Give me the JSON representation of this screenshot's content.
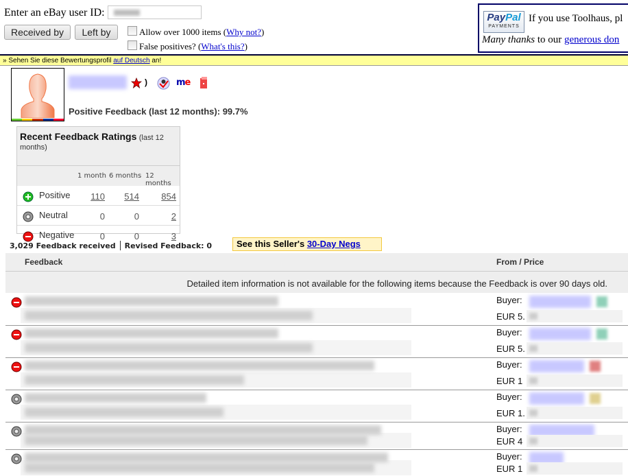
{
  "form": {
    "user_id_label": "Enter an eBay user ID:",
    "user_id_value_redacted": true,
    "received_by_button": "Received by",
    "left_by_button": "Left by",
    "allow_over_1000_label": "Allow over 1000 items",
    "allow_over_1000_checked": false,
    "why_not_link": "Why not?",
    "false_positives_label": "False positives?",
    "false_positives_checked": false,
    "whats_this_link": "What's this?"
  },
  "donate": {
    "paypal_logo_top": "PayPal",
    "paypal_logo_bottom": "PAYMENTS",
    "line1": "If you use Toolhaus, pl",
    "line2_italic": "Many thanks",
    "line2_text": " to our ",
    "line2_link": "generous don"
  },
  "lang_bar": {
    "prefix": "» Sehen Sie diese Bewertungsprofil ",
    "link": "auf Deutsch",
    "suffix": " an!"
  },
  "profile": {
    "username_redacted": true,
    "score_suffix": ")",
    "icons": [
      "red-star-icon",
      "id-verified-icon",
      "me-page-icon",
      "store-door-icon"
    ],
    "positive_feedback_label": "Positive Feedback (last 12 months):",
    "positive_feedback_value": "99.7%"
  },
  "ratings": {
    "title": "Recent Feedback Ratings",
    "title_small": "(last 12 months)",
    "columns": [
      "1 month",
      "6 months",
      "12 months"
    ],
    "rows": [
      {
        "label": "Positive",
        "icon": "positive-icon",
        "values": [
          "110",
          "514",
          "854"
        ],
        "linked": [
          true,
          true,
          true
        ]
      },
      {
        "label": "Neutral",
        "icon": "neutral-icon",
        "values": [
          "0",
          "0",
          "2"
        ],
        "linked": [
          false,
          false,
          true
        ]
      },
      {
        "label": "Negative",
        "icon": "negative-icon",
        "values": [
          "0",
          "0",
          "3"
        ],
        "linked": [
          false,
          false,
          true
        ]
      }
    ]
  },
  "summary": {
    "feedback_received": "3,029 Feedback received",
    "revised_feedback": "Revised Feedback: 0",
    "negs_prefix": "See this Seller's ",
    "negs_link": "30-Day Negs"
  },
  "feedback_table": {
    "col_feedback": "Feedback",
    "col_from_price": "From / Price",
    "notice": "Detailed item information is not available for the following items because the Feedback is over 90 days old.",
    "rows": [
      {
        "type": "negative",
        "buyer_label": "Buyer:",
        "price_prefix": "EUR 5.",
        "star_color": "#8fd0b8"
      },
      {
        "type": "negative",
        "buyer_label": "Buyer:",
        "price_prefix": "EUR 5.",
        "star_color": "#8fd0b8"
      },
      {
        "type": "negative",
        "buyer_label": "Buyer:",
        "price_prefix": "EUR 1",
        "star_color": "#e08080"
      },
      {
        "type": "neutral",
        "buyer_label": "Buyer:",
        "price_prefix": "EUR 1.",
        "star_color": "#e0d090"
      },
      {
        "type": "neutral",
        "buyer_label": "Buyer:",
        "price_prefix": "EUR 4",
        "star_color": ""
      },
      {
        "type": "neutral",
        "buyer_label": "Buyer:",
        "price_prefix": "EUR 1",
        "star_color": ""
      }
    ]
  },
  "colors": {
    "lang_bar_bg": "#ffff99",
    "link": "#0000cc",
    "negs_bg": "#fff4c8",
    "table_header_bg": "#eeeeee"
  }
}
